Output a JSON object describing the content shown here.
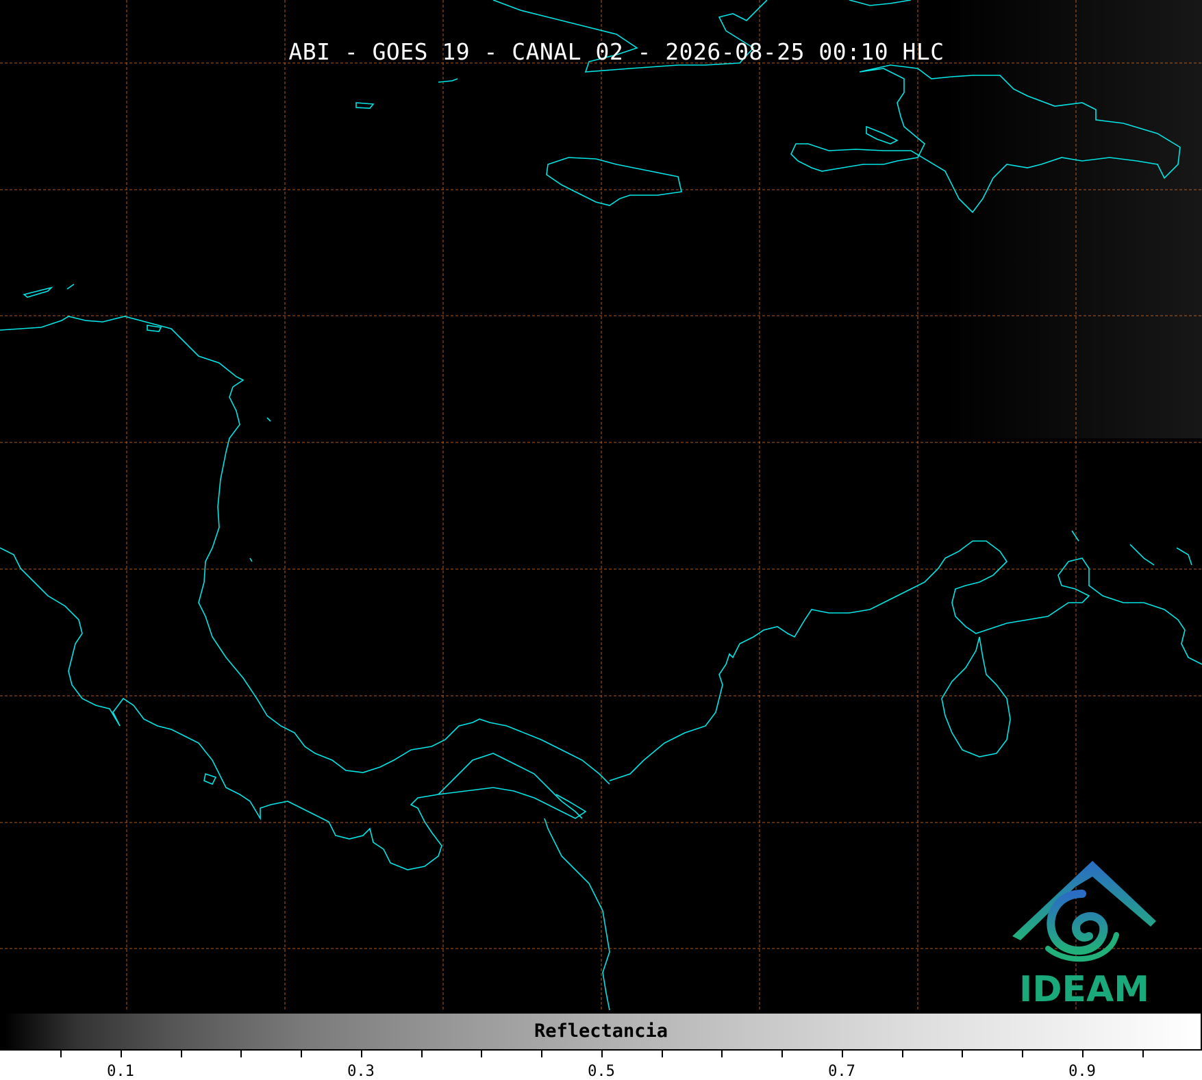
{
  "title": "ABI - GOES 19 - CANAL 02 - 2026-08-25 00:10 HLC",
  "colorbar": {
    "label": "Reflectancia",
    "ticks": [
      "0.1",
      "0.3",
      "0.5",
      "0.7",
      "0.9"
    ]
  },
  "logo": {
    "text": "IDEAM"
  },
  "colors": {
    "coastline": "#00e5e5",
    "grid": "#d2691e",
    "background": "#000000"
  }
}
